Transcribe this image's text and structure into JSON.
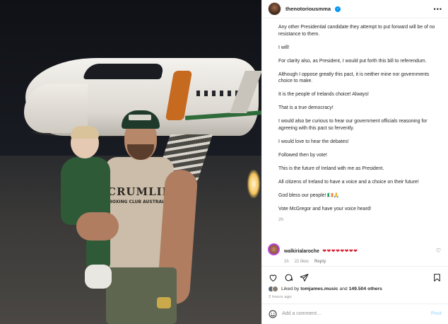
{
  "post": {
    "username": "thenotoriousmma",
    "caption": [
      "Any other Presidential candidate they attempt to put forward will be of no resistance to them.",
      "I will!",
      "For clarity also, as President, I would put forth this bill to referendum.",
      "Although I oppose greatly this pact, it is neither mine nor governments choice to make.",
      "It is the people of Irelands choice! Always!",
      "That is a true democracy!",
      "I would also be curious to hear our government officials reasoning for agreeing with this pact so fervently.",
      "I would love to hear the debates!",
      "Followed then by vote!",
      "This is the future of Ireland with me as President.",
      "All citizens of Ireland to have a voice and a choice on their future!",
      "God bless our people! 🇮🇪🙏",
      "Vote McGregor and have your voice heard!"
    ],
    "caption_age": "2h"
  },
  "photo": {
    "shirt_print": "CRUMLIN",
    "shirt_subprint": "BOXING CLUB AUSTRALIA"
  },
  "comment": {
    "username": "walkirialaroche",
    "text": "❤❤❤❤❤❤❤❤",
    "age": "1h",
    "likes": "22 likes",
    "reply": "Reply"
  },
  "likes": {
    "prefix": "Liked by ",
    "user": "tomjames.music",
    "middle": " and ",
    "count": "149.504 others"
  },
  "time_ago": "2 hours ago",
  "add_comment": {
    "placeholder": "Add a comment…",
    "post_label": "Post"
  },
  "icons": [
    "verified-icon",
    "more-icon",
    "heart-icon",
    "comment-icon",
    "share-icon",
    "bookmark-icon",
    "emoji-icon"
  ]
}
